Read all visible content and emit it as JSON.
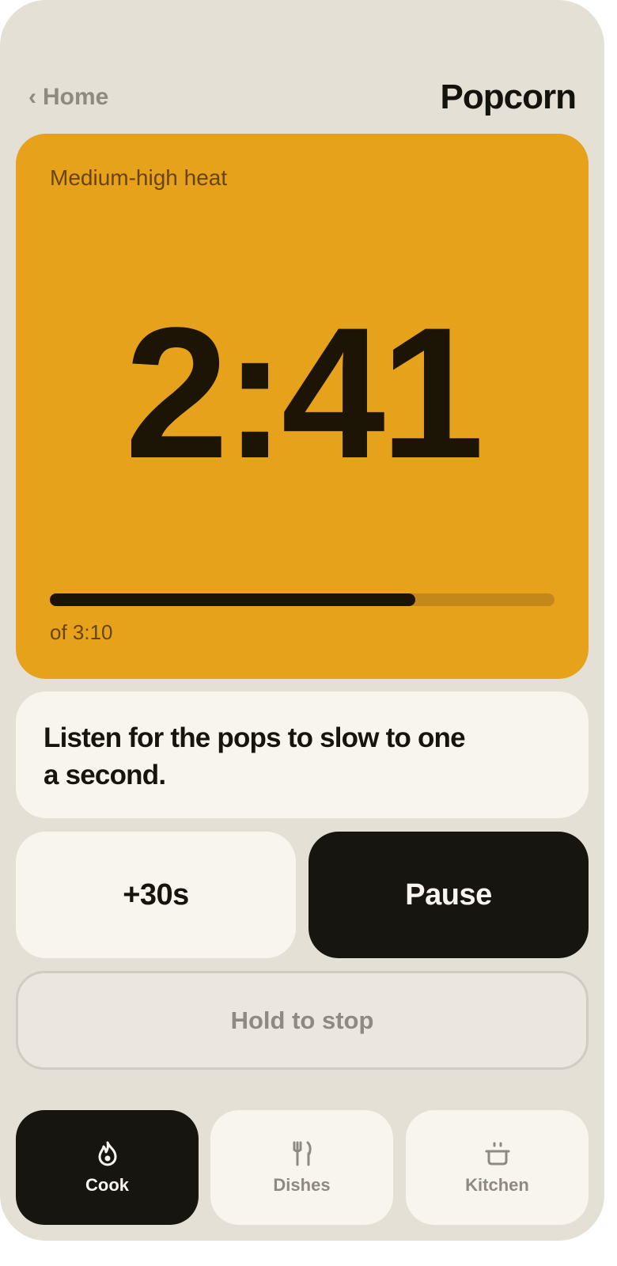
{
  "header": {
    "back_chevron": "‹",
    "back_label": "Home",
    "title": "Popcorn"
  },
  "timer": {
    "heat_level": "Medium-high heat",
    "remaining": "2:41",
    "total_label": "of 3:10",
    "progress_fraction": 0.7236
  },
  "tip": {
    "text": "Listen for the pops to slow to one a second."
  },
  "actions": {
    "add_time_label": "+30s",
    "pause_label": "Pause",
    "stop_label": "Hold to stop"
  },
  "nav": {
    "items": [
      {
        "label": "Cook",
        "icon": "flame-icon",
        "active": true
      },
      {
        "label": "Dishes",
        "icon": "fork-knife-icon",
        "active": false
      },
      {
        "label": "Kitchen",
        "icon": "pot-icon",
        "active": false
      }
    ]
  },
  "colors": {
    "background": "#e4e0d6",
    "accent": "#e6a21b",
    "dark": "#16150f",
    "card": "#f8f5ee",
    "muted": "#8e8a80"
  }
}
